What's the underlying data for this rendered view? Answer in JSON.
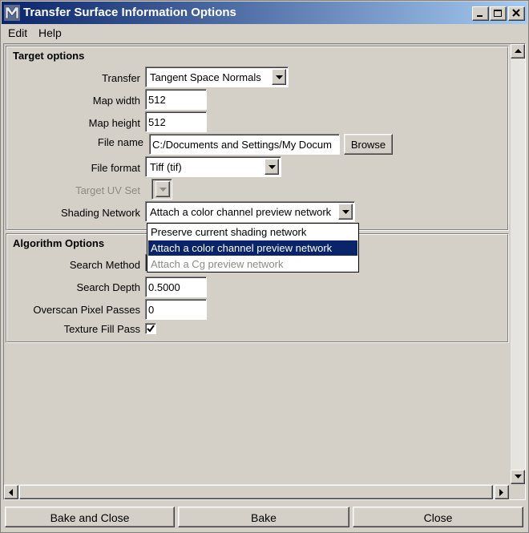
{
  "window": {
    "title": "Transfer Surface Information Options"
  },
  "menu": {
    "edit": "Edit",
    "help": "Help"
  },
  "target": {
    "section_title": "Target options",
    "transfer_label": "Transfer",
    "transfer_value": "Tangent Space Normals",
    "map_width_label": "Map width",
    "map_width_value": "512",
    "map_height_label": "Map height",
    "map_height_value": "512",
    "file_name_label": "File name",
    "file_name_value": "C:/Documents and Settings/My Docum",
    "browse_label": "Browse",
    "file_format_label": "File format",
    "file_format_value": "Tiff (tif)",
    "uv_set_label": "Target UV Set",
    "shading_label": "Shading Network",
    "shading_value": "Attach a color channel preview network"
  },
  "shading_options": [
    "Preserve current shading network",
    "Attach a color channel preview network",
    "Attach a Cg preview network"
  ],
  "algorithm": {
    "section_title": "Algorithm Options",
    "search_method_label": "Search Method",
    "search_depth_label": "Search Depth",
    "search_depth_value": "0.5000",
    "overscan_label": "Overscan Pixel Passes",
    "overscan_value": "0",
    "texture_fill_label": "Texture Fill Pass",
    "texture_fill_checked": true
  },
  "buttons": {
    "bake_close": "Bake and Close",
    "bake": "Bake",
    "close": "Close"
  },
  "colors": {
    "title_start": "#0a246a",
    "title_end": "#a6caf0",
    "face": "#d4d0c8",
    "selection": "#0a246a"
  }
}
